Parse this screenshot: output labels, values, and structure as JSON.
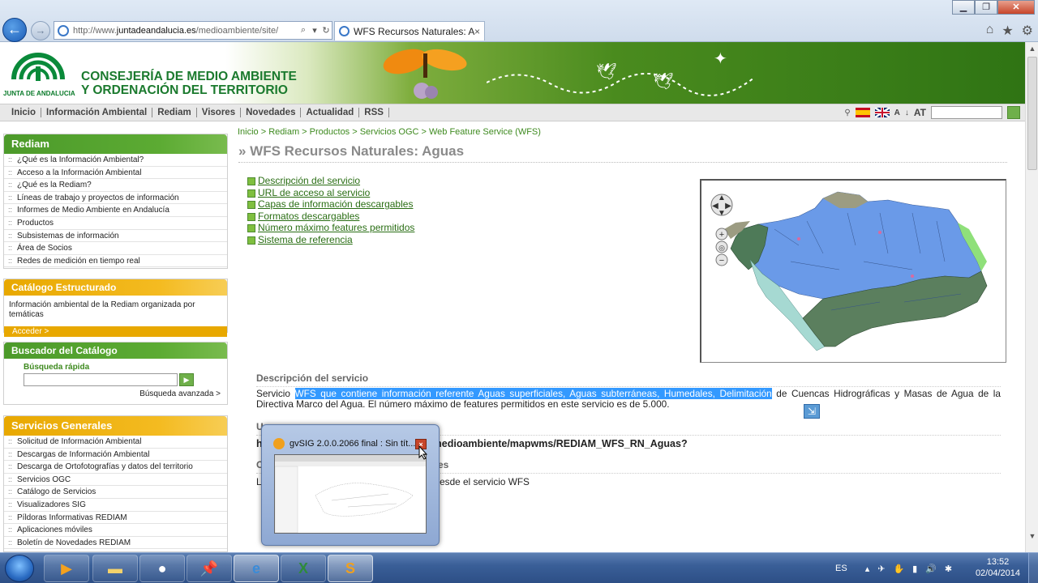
{
  "browser": {
    "address": "http://www.juntadeandalucia.es/medioambiente/site/",
    "address_prefix": "http://www.",
    "address_domain": "juntadeandalucia.es",
    "address_suffix": "/medioambiente/site/",
    "tab_title": "WFS Recursos Naturales: A...",
    "tab_close": "×"
  },
  "header": {
    "logo_text": "JUNTA DE ANDALUCIA",
    "org_line1": "CONSEJERÍA DE MEDIO AMBIENTE",
    "org_line2": "Y ORDENACIÓN DEL TERRITORIO"
  },
  "nav": {
    "items": [
      "Inicio",
      "Información Ambiental",
      "Rediam",
      "Visores",
      "Novedades",
      "Actualidad",
      "RSS"
    ],
    "font_small": "A",
    "font_big": "AT"
  },
  "sidebar": {
    "rediam": {
      "title": "Rediam",
      "items": [
        "¿Qué es la Información Ambiental?",
        "Acceso a la Información Ambiental",
        "¿Qué es la Rediam?",
        "Líneas de trabajo y proyectos de información",
        "Informes de Medio Ambiente en Andalucía",
        "Productos",
        "Subsistemas de información",
        "Área de Socios",
        "Redes de medición en tiempo real"
      ]
    },
    "catalogo": {
      "title": "Catálogo Estructurado",
      "desc": "Información ambiental de la Rediam organizada por temáticas",
      "link": "Acceder >"
    },
    "buscador": {
      "title": "Buscador del Catálogo",
      "label": "Búsqueda rápida",
      "advanced": "Búsqueda avanzada >"
    },
    "servicios": {
      "title": "Servicios Generales",
      "items": [
        "Solicitud de Información Ambiental",
        "Descargas de Información Ambiental",
        "Descarga de Ortofotografías y datos del territorio",
        "Servicios OGC",
        "Catálogo de Servicios",
        "Visualizadores SIG",
        "Píldoras Informativas REDIAM",
        "Aplicaciones móviles",
        "Boletín de Novedades REDIAM"
      ]
    }
  },
  "main": {
    "breadcrumb": "Inicio > Rediam > Productos > Servicios OGC > Web Feature Service (WFS)",
    "title": "» WFS Recursos Naturales: Aguas",
    "links": [
      "Descripción del servicio",
      "URL de acceso al servicio",
      "Capas de información descargables",
      "Formatos descargables",
      "Número máximo features permitidos",
      "Sistema de referencia"
    ],
    "desc_heading": "Descripción del servicio",
    "desc_prefix": "Servicio ",
    "desc_highlight": "WFS que contiene información referente Aguas superficiales, Aguas subterráneas, Humedales, Delimitación",
    "desc_rest": " de Cuencas Hidrográficas y Masas de Agua de la Directiva Marco del Agua. El número máximo de features permitidos en este servicio es de 5.000.",
    "url_heading_partial": "U",
    "url_partial": "medioambiente/mapwms/REDIAM_WFS_RN_Aguas?",
    "url_first": "h",
    "cap_heading_partial_left": "C",
    "cap_heading_partial_right": "les",
    "cap_partial_left": "L",
    "cap_partial_right": "desde el servicio WFS"
  },
  "thumbnail": {
    "title": "gvSIG 2.0.0.2066 final : Sin tít...",
    "close": "×"
  },
  "taskbar": {
    "language": "ES",
    "time": "13:52",
    "date": "02/04/2014"
  },
  "colors": {
    "green": "#4c9a2a",
    "orange": "#e8a800",
    "link_green": "#2a6e14",
    "highlight": "#3399ff"
  }
}
